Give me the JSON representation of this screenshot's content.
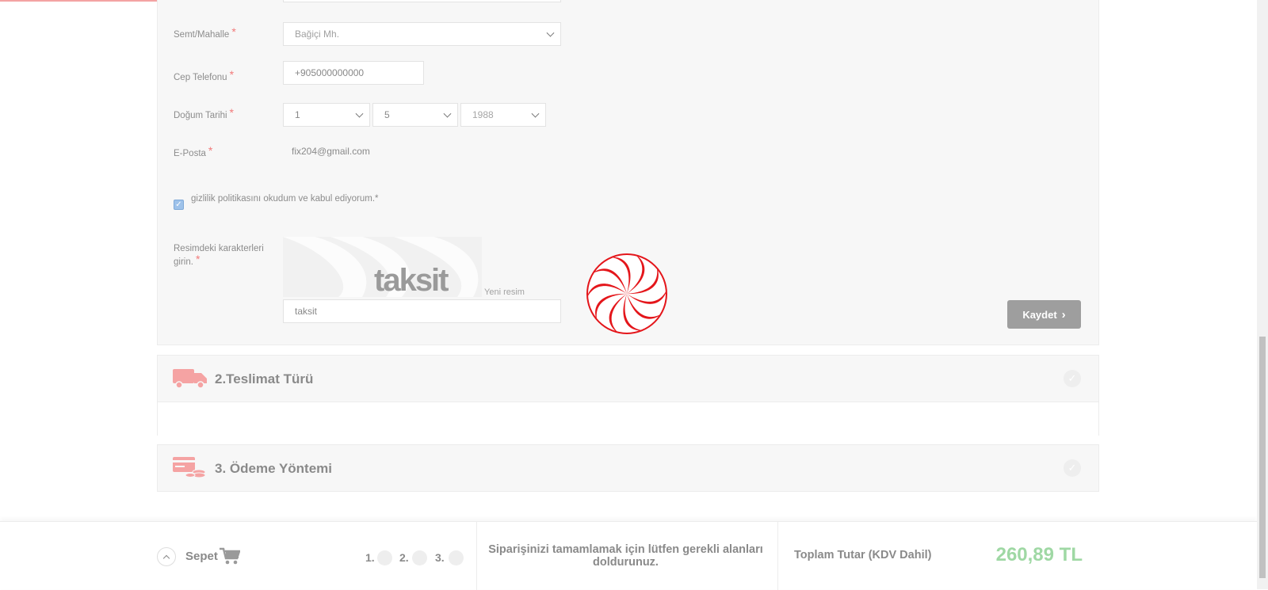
{
  "form": {
    "district_label": "Semt/Mahalle",
    "district_value": "Bağiçi Mh.",
    "phone_label": "Cep Telefonu",
    "phone_value": "+905000000000",
    "birthdate_label": "Doğum Tarihi",
    "birth_day": "1",
    "birth_month": "5",
    "birth_year": "1988",
    "email_label": "E-Posta",
    "email_value": "fix204@gmail.com",
    "privacy_text": "gizlilik politikasını okudum ve kabul ediyorum.*",
    "captcha_label": "Resimdeki karakterleri girin.",
    "captcha_image_text": "taksit",
    "captcha_new_image": "Yeni resim",
    "captcha_value": "taksit",
    "required_mark": "*",
    "save_label": "Kaydet",
    "save_chevron": "›"
  },
  "sections": {
    "delivery_title": "2.Teslimat Türü",
    "payment_title": "3. Ödeme Yöntemi"
  },
  "footer": {
    "cart_label": "Sepet",
    "step1": "1.",
    "step2": "2.",
    "step3": "3.",
    "message": "Siparişinizi tamamlamak için lütfen gerekli alanları doldurunuz.",
    "total_label": "Toplam Tutar (KDV Dahil)",
    "total_value": "260,89 TL"
  },
  "colors": {
    "accent_red": "#e4161b",
    "total_green": "#9fd8a4",
    "icon_pink": "#f5a3a3"
  },
  "icons": [
    "chevron-down-icon",
    "spiral-logo-icon",
    "truck-icon",
    "card-coins-icon",
    "check-circle-icon",
    "chevron-up-icon",
    "cart-icon"
  ]
}
